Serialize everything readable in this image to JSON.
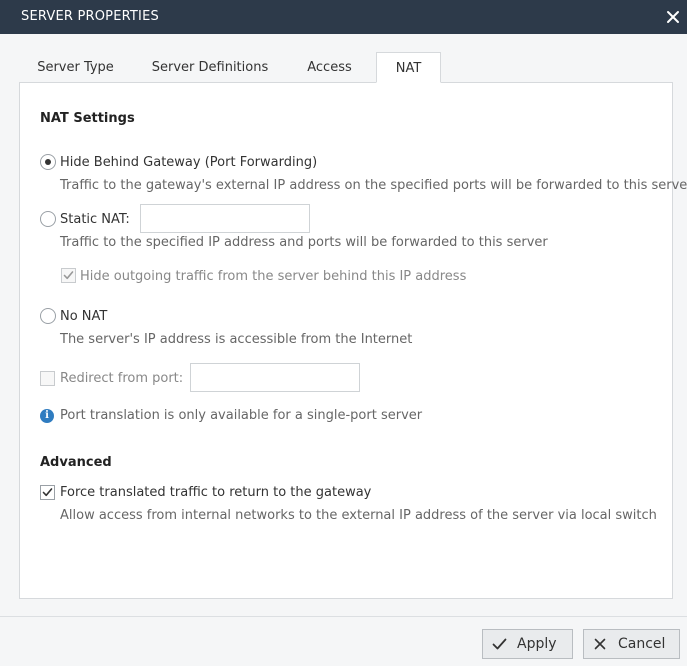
{
  "window": {
    "title": "SERVER PROPERTIES",
    "close_glyph": "✕"
  },
  "tabs": [
    {
      "label": "Server Type",
      "active": false
    },
    {
      "label": "Server Definitions",
      "active": false
    },
    {
      "label": "Access",
      "active": false
    },
    {
      "label": "NAT",
      "active": true
    }
  ],
  "nat_settings": {
    "title": "NAT Settings",
    "hide_behind_gateway": {
      "label": "Hide Behind Gateway (Port Forwarding)",
      "description": "Traffic to the gateway's external IP address on the specified ports will be forwarded to this server",
      "selected": true
    },
    "static_nat": {
      "label": "Static NAT:",
      "value": "",
      "description": "Traffic to the specified IP address and ports will be forwarded to this server",
      "selected": false,
      "hide_outgoing": {
        "label": "Hide outgoing traffic from the server behind this IP address",
        "checked": true,
        "enabled": false
      }
    },
    "no_nat": {
      "label": "No NAT",
      "description": "The server's IP address is accessible from the Internet",
      "selected": false
    },
    "redirect": {
      "label": "Redirect from port:",
      "value": "",
      "checked": false,
      "enabled": false
    },
    "info": "Port translation is only available for a single-port server"
  },
  "advanced": {
    "title": "Advanced",
    "force_translated": {
      "label": "Force translated traffic to return to the gateway",
      "description": "Allow access from internal networks to the external IP address of the server via local switch",
      "checked": true
    }
  },
  "footer": {
    "apply_label": "Apply",
    "cancel_label": "Cancel"
  },
  "colors": {
    "titlebar": "#2d3a4a",
    "info_blue": "#2f7cc0"
  }
}
